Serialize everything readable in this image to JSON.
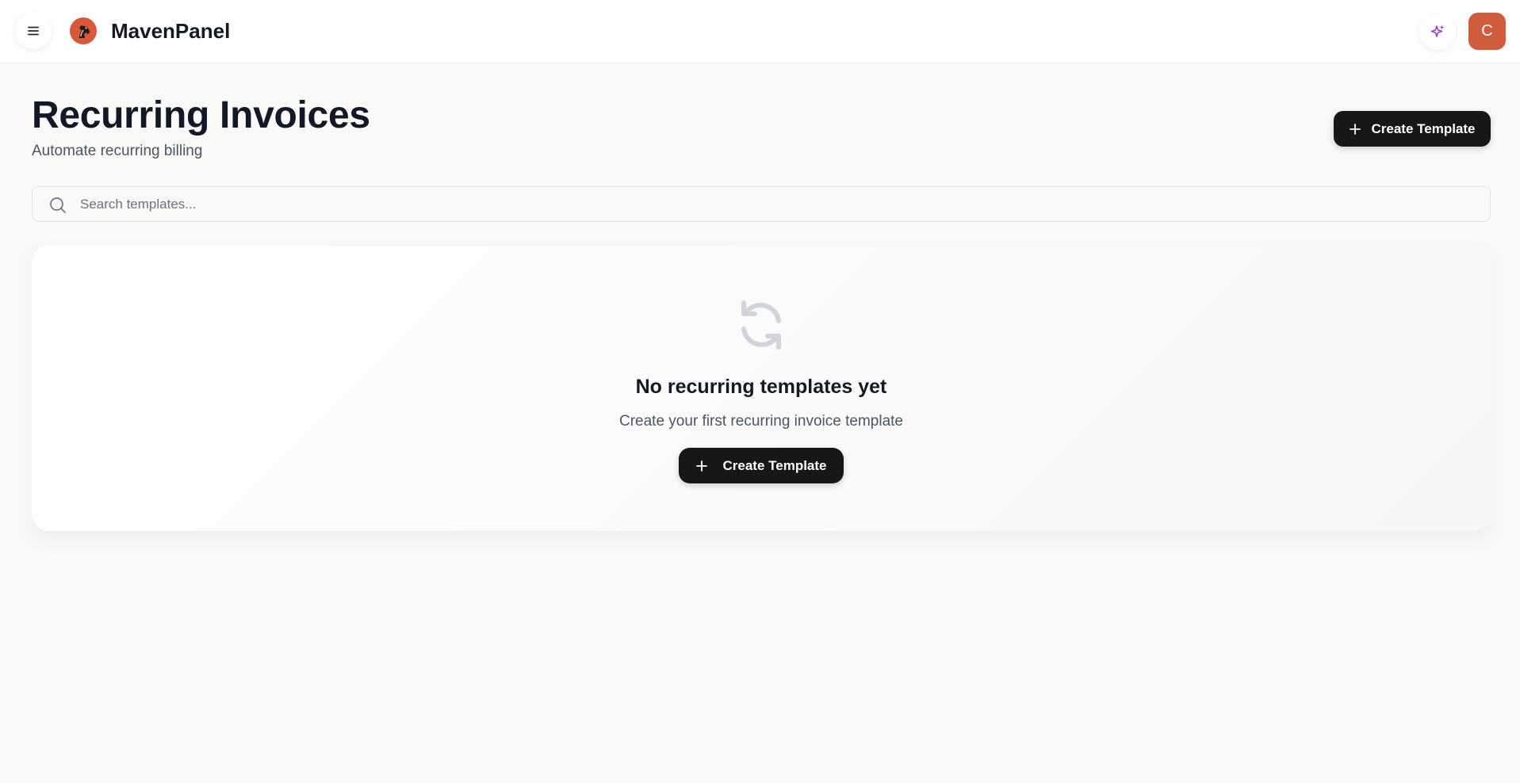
{
  "header": {
    "brand": "MavenPanel",
    "avatar_initial": "C",
    "icons": {
      "menu": "hamburger-menu-icon",
      "logo": "horse-logo-icon",
      "assistant": "sparkles-icon"
    },
    "colors": {
      "brand_accent": "#d9573a",
      "avatar_bg": "#cf5c3c",
      "sparkle": "#9c3ec9"
    }
  },
  "page": {
    "title": "Recurring Invoices",
    "subtitle": "Automate recurring billing",
    "create_button": "Create Template"
  },
  "search": {
    "placeholder": "Search templates...",
    "value": ""
  },
  "empty_state": {
    "icon": "refresh-cycle-icon",
    "title": "No recurring templates yet",
    "description": "Create your first recurring invoice template",
    "button": "Create Template"
  },
  "colors": {
    "button_bg": "#171717",
    "page_bg": "#f9f9f8"
  }
}
